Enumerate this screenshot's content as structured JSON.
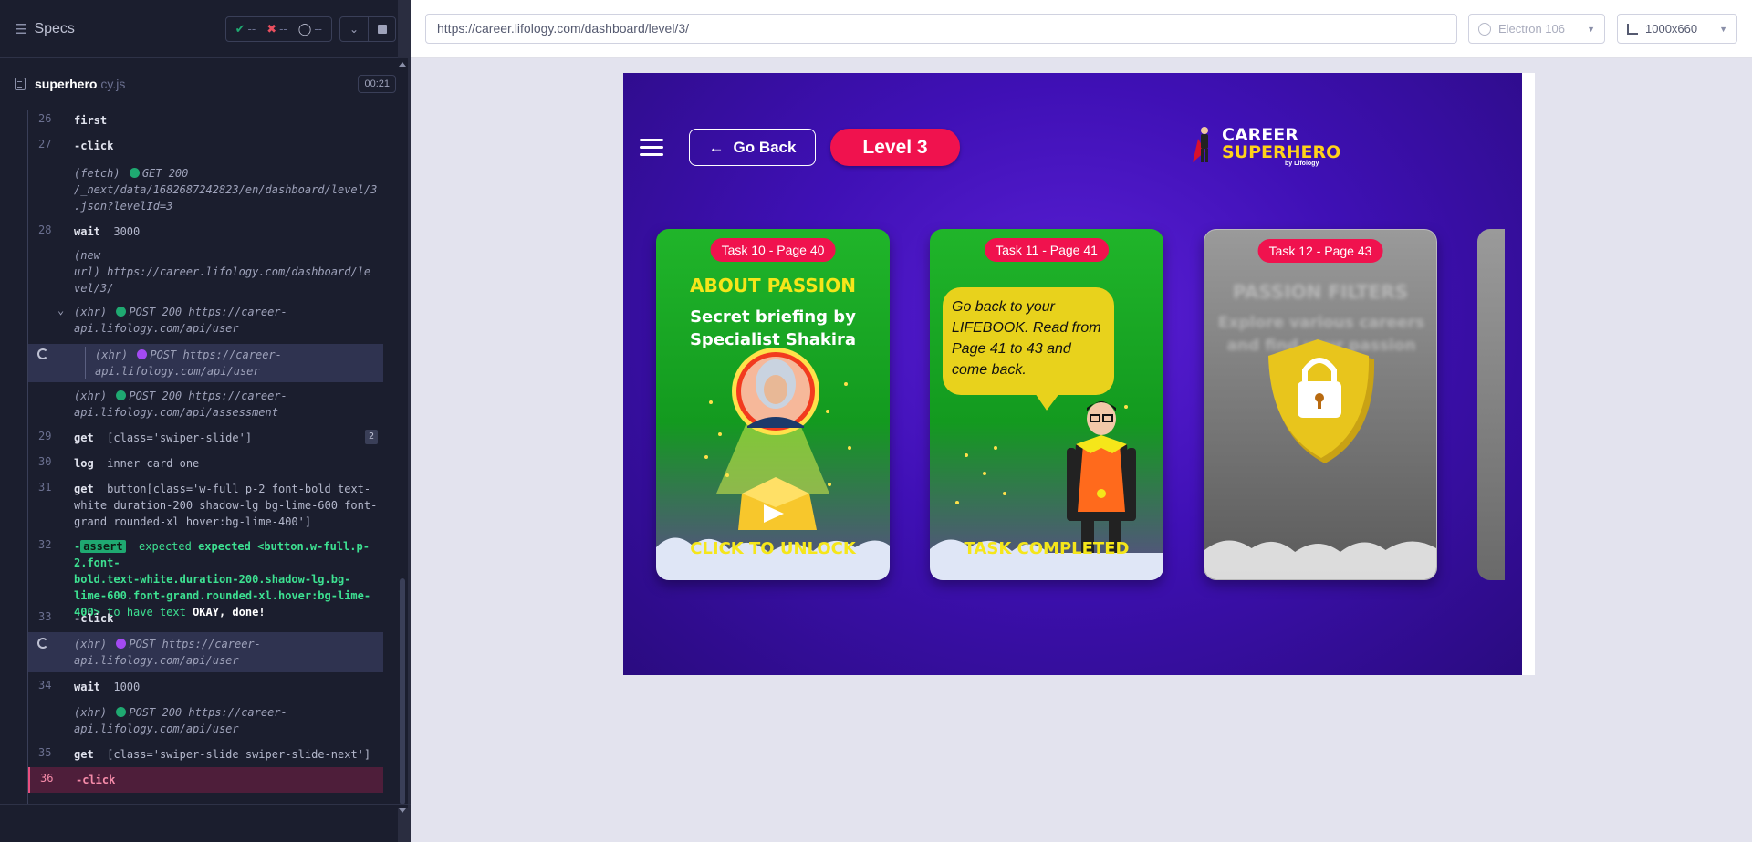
{
  "reporter": {
    "title": "Specs",
    "stats": {
      "passed": "--",
      "failed": "--",
      "pending": "--"
    },
    "spec_file": {
      "name": "superhero",
      "ext": ".cy.js",
      "duration": "00:21"
    },
    "commands": {
      "c26": {
        "num": "26",
        "name": "first"
      },
      "c27": {
        "num": "27",
        "name": "-click"
      },
      "fetch1": {
        "kind": "(fetch)",
        "method": "GET 200",
        "url1": "/_next/data/1682687242823/en/dashboard/level/3",
        "url2": ".json?levelId=3"
      },
      "c28": {
        "num": "28",
        "name": "wait",
        "msg": "3000"
      },
      "newurl": {
        "kind1": "(new",
        "kind2": "url)",
        "url1": "https://career.lifology.com/dashboard/le",
        "url2": "vel/3/"
      },
      "xhr1": {
        "kind": "(xhr)",
        "method": "POST 200",
        "url1": "https://career-",
        "url2": "api.lifology.com/api/user"
      },
      "xhr2": {
        "kind": "(xhr)",
        "method": "POST",
        "url1": "https://career-",
        "url2": "api.lifology.com/api/user"
      },
      "xhr3": {
        "kind": "(xhr)",
        "method": "POST 200",
        "url1": "https://career-",
        "url2": "api.lifology.com/api/assessment"
      },
      "c29": {
        "num": "29",
        "name": "get",
        "msg": "[class='swiper-slide']",
        "count": "2"
      },
      "c30": {
        "num": "30",
        "name": "log",
        "msg": "inner card one"
      },
      "c31": {
        "num": "31",
        "name": "get",
        "msg1": "button[class='w-full p-2 font-bold text-",
        "msg2": "white duration-200 shadow-lg bg-lime-600 font-",
        "msg3": "grand rounded-xl hover:bg-lime-400']"
      },
      "c32": {
        "num": "32",
        "tag": "assert",
        "pre": "-",
        "l1": "expected <button.w-full.p-2.font-",
        "l2": "bold.text-white.duration-200.shadow-lg.bg-",
        "l3": "lime-600.font-grand.rounded-xl.hover:bg-lime-",
        "l4a": "400>",
        "l4b": "to have text",
        "l4c": "OKAY, done!"
      },
      "c33": {
        "num": "33",
        "name": "-click"
      },
      "xhr4": {
        "kind": "(xhr)",
        "method": "POST",
        "url1": "https://career-",
        "url2": "api.lifology.com/api/user"
      },
      "c34": {
        "num": "34",
        "name": "wait",
        "msg": "1000"
      },
      "xhr5": {
        "kind": "(xhr)",
        "method": "POST 200",
        "url1": "https://career-",
        "url2": "api.lifology.com/api/user"
      },
      "c35": {
        "num": "35",
        "name": "get",
        "msg": "[class='swiper-slide swiper-slide-next']"
      },
      "c36": {
        "num": "36",
        "name": "-click"
      }
    }
  },
  "aut": {
    "url": "https://career.lifology.com/dashboard/level/3/",
    "browser": "Electron 106",
    "viewport": "1000x660"
  },
  "game": {
    "go_back": "Go Back",
    "level": "Level 3",
    "logo": {
      "line1": "CAREER",
      "line2": "SUPERHERO",
      "line3": "by Lifology"
    },
    "cards": [
      {
        "badge": "Task 10 - Page 40",
        "title": "ABOUT PASSION",
        "sub": "Secret briefing by Specialist Shakira",
        "bottom": "CLICK TO UNLOCK"
      },
      {
        "badge": "Task 11 - Page 41",
        "speech": "Go back to your LIFEBOOK. Read from Page 41 to 43 and come back.",
        "bottom": "TASK COMPLETED"
      },
      {
        "badge": "Task 12 - Page 43",
        "title": "PASSION FILTERS",
        "sub": "Explore various careers and find your passion"
      }
    ]
  },
  "colors": {
    "accent": "#f0124e",
    "card_green": "#20b52a",
    "game_bg": "#3f10b5",
    "pass": "#1fa971",
    "fail": "#e94f5f"
  }
}
